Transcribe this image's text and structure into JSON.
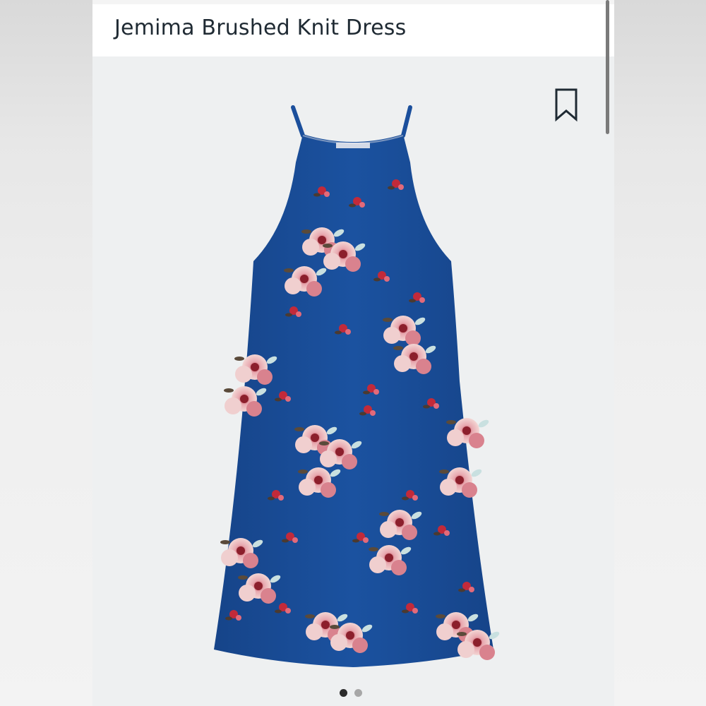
{
  "product": {
    "title": "Jemima Brushed Knit Dress"
  },
  "icons": {
    "bookmark": "bookmark-icon"
  },
  "carousel": {
    "total": 2,
    "active_index": 0
  },
  "colors": {
    "background": "#eef0f1",
    "dress_blue": "#1a4f9a",
    "flower_pink": "#e8a9b0",
    "flower_red": "#b52838",
    "dot_active": "#2b2b2b",
    "dot_inactive": "#a7a7a7"
  }
}
